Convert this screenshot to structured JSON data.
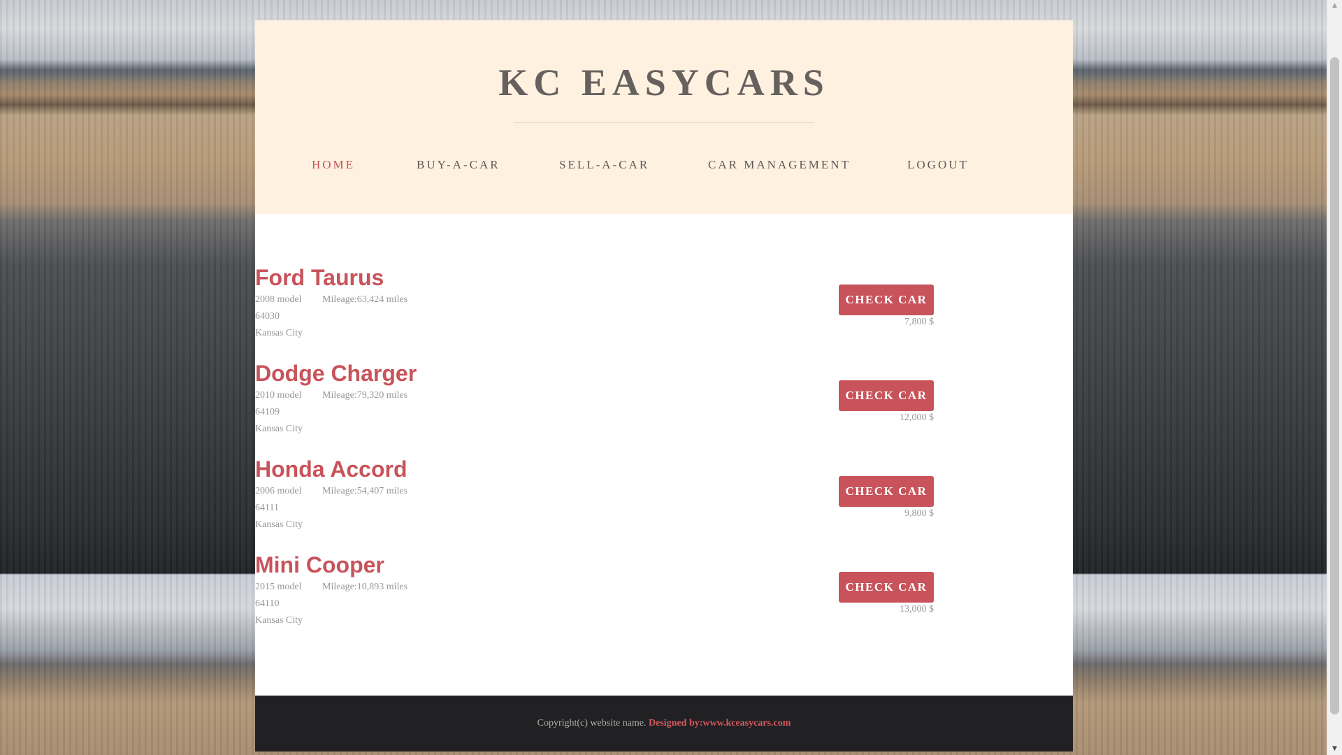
{
  "header": {
    "site_title": "KC EASYCARS",
    "nav": [
      {
        "label": "HOME",
        "active": true
      },
      {
        "label": "BUY-A-CAR",
        "active": false
      },
      {
        "label": "SELL-A-CAR",
        "active": false
      },
      {
        "label": "CAR MANAGEMENT",
        "active": false
      },
      {
        "label": "LOGOUT",
        "active": false
      }
    ]
  },
  "cars": [
    {
      "name": "Ford Taurus",
      "model": "2008 model",
      "mileage": "Mileage:63,424 miles",
      "zip": "64030",
      "city": "Kansas City",
      "button": "CHECK CAR",
      "price": "7,800 $"
    },
    {
      "name": "Dodge Charger",
      "model": "2010 model",
      "mileage": "Mileage:79,320 miles",
      "zip": "64109",
      "city": "Kansas City",
      "button": "CHECK CAR",
      "price": "12,000 $"
    },
    {
      "name": "Honda Accord",
      "model": "2006 model",
      "mileage": "Mileage:54,407 miles",
      "zip": "64111",
      "city": "Kansas City",
      "button": "CHECK CAR",
      "price": "9,800 $"
    },
    {
      "name": "Mini Cooper",
      "model": "2015 model",
      "mileage": "Mileage:10,893 miles",
      "zip": "64110",
      "city": "Kansas City",
      "button": "CHECK CAR",
      "price": "13,000 $"
    }
  ],
  "footer": {
    "copyright": "Copyright(c) website name. ",
    "credit": "Designed by:www.kceasycars.com"
  },
  "scrollbar": {
    "up_icon": "triangle-up",
    "down_icon": "triangle-down"
  },
  "colors": {
    "accent": "#c8535a",
    "header_bg": "#fef1df",
    "footer_bg": "#212124"
  }
}
